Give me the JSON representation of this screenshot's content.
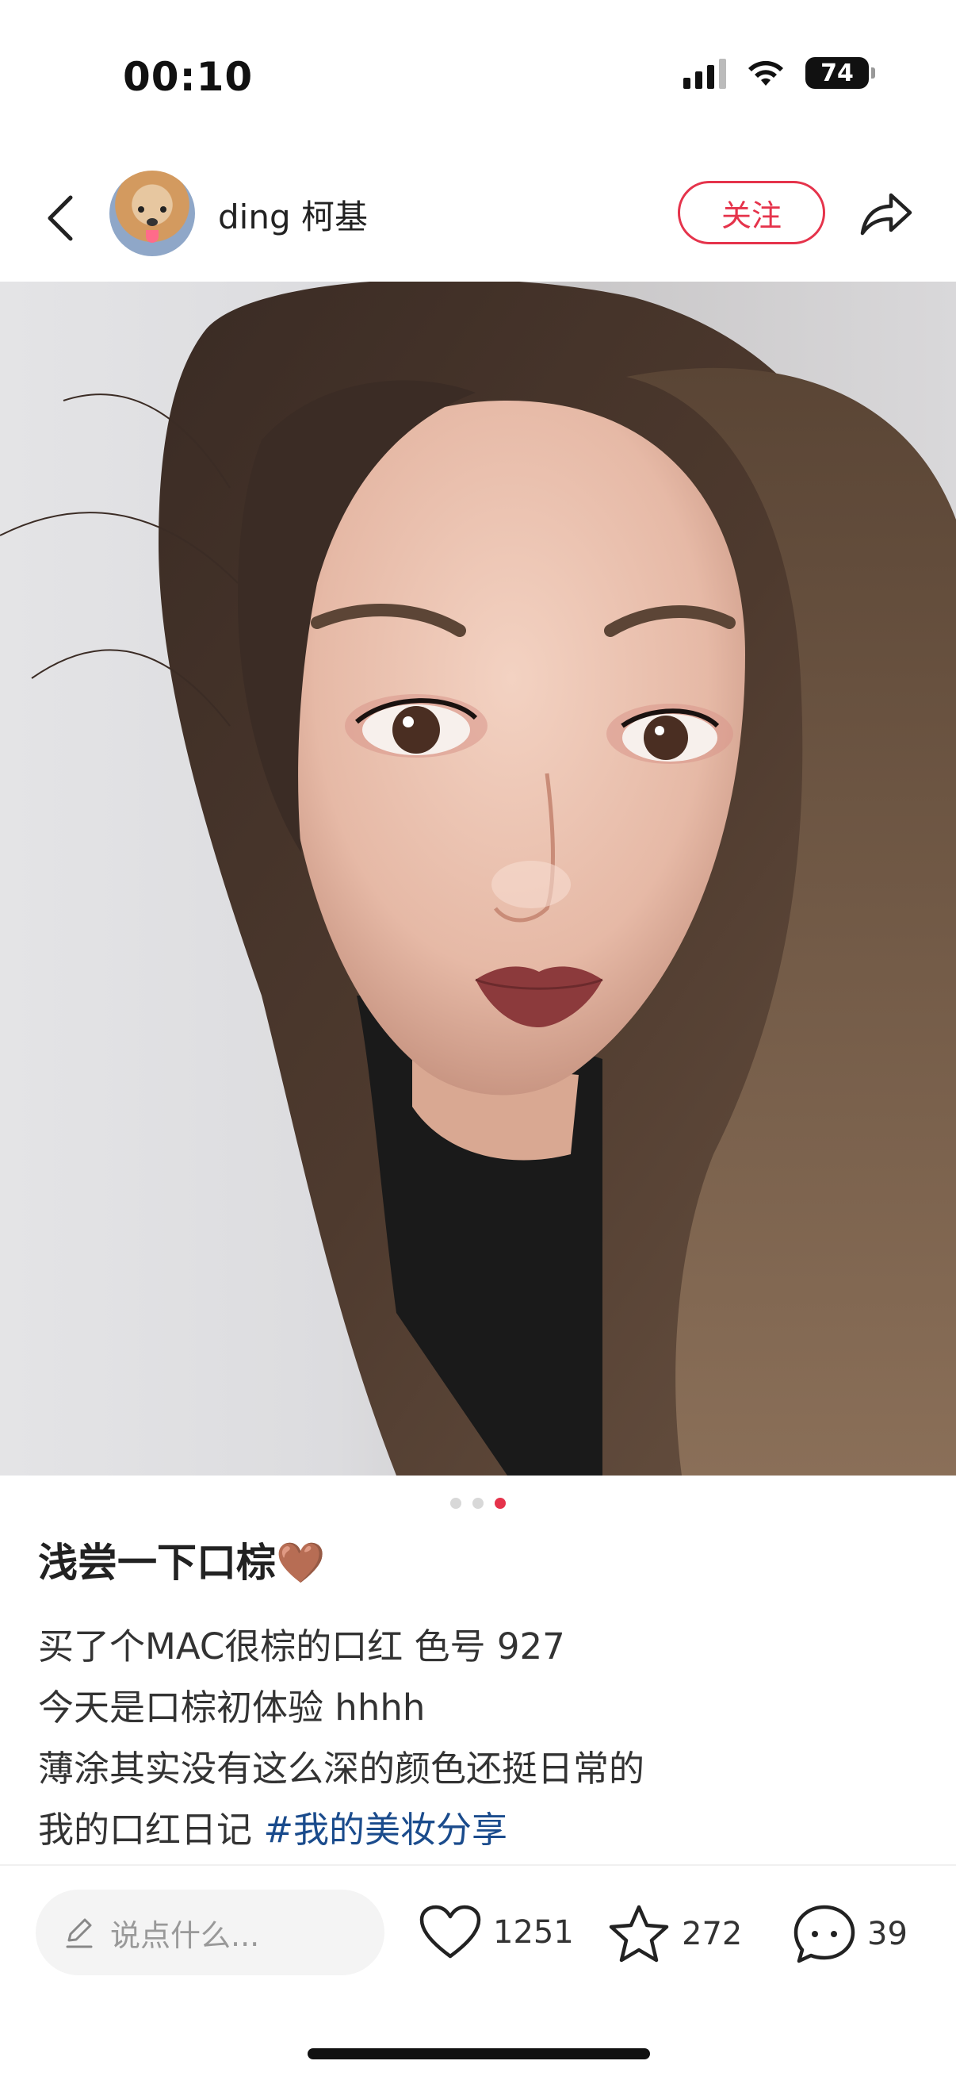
{
  "status_bar": {
    "time": "00:10",
    "battery": "74"
  },
  "header": {
    "username": "ding 柯基",
    "follow_label": "关注"
  },
  "carousel": {
    "total": 3,
    "active_index": 3
  },
  "post": {
    "title": "浅尝一下口棕🤎",
    "lines": [
      "买了个MAC很棕的口红 色号 927",
      "今天是口棕初体验 hhhh",
      "薄涂其实没有这么深的颜色还挺日常的"
    ],
    "last_line_text": "我的口红日记 ",
    "hashtag": "#我的美妆分享"
  },
  "bottom_bar": {
    "comment_placeholder": "说点什么...",
    "likes": "1251",
    "favorites": "272",
    "comments": "39"
  },
  "colors": {
    "accent": "#e5334b",
    "hashtag": "#1a4b8c"
  }
}
